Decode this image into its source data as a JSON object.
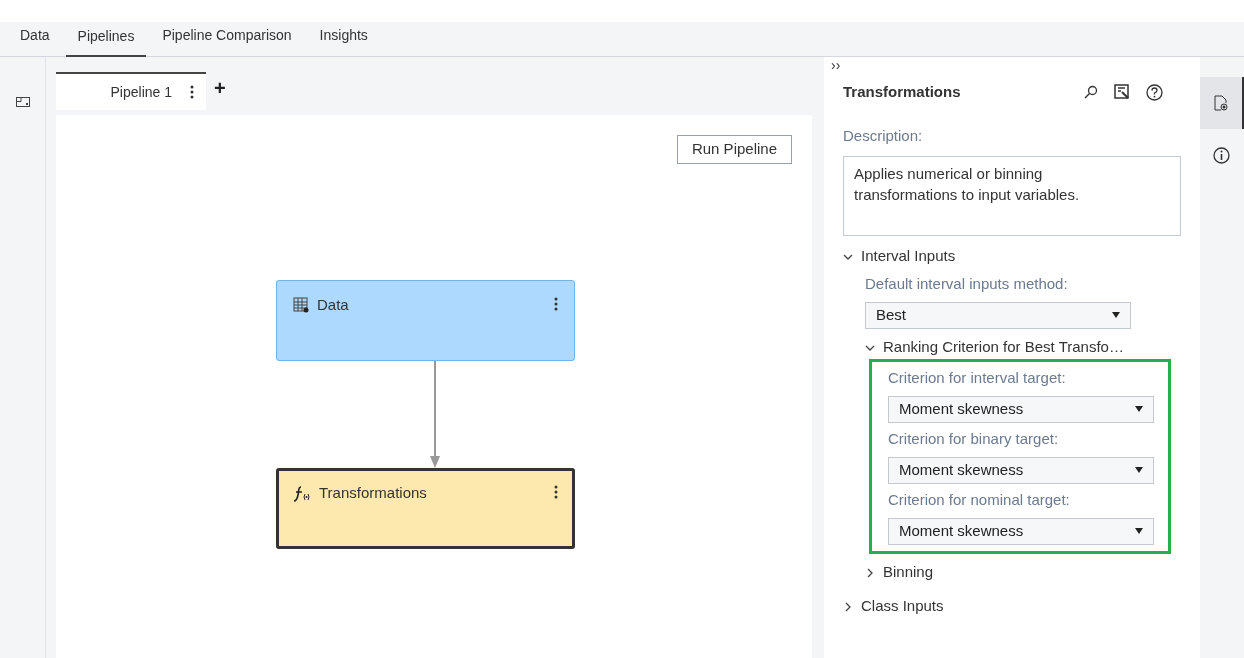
{
  "main_tabs": [
    {
      "label": "Data",
      "selected": false
    },
    {
      "label": "Pipelines",
      "selected": true
    },
    {
      "label": "Pipeline Comparison",
      "selected": false
    },
    {
      "label": "Insights",
      "selected": false
    }
  ],
  "pipeline_tabs": [
    {
      "label": "Pipeline 1",
      "selected": true
    }
  ],
  "add_tab": "+",
  "run_button": "Run Pipeline",
  "nodes": [
    {
      "kind": "data",
      "label": "Data",
      "selected": false
    },
    {
      "kind": "transform",
      "label": "Transformations",
      "selected": true
    }
  ],
  "panel": {
    "collapse": "››",
    "title": "Transformations",
    "description_label": "Description:",
    "description": "Applies numerical or binning transformations to input variables.",
    "sections": [
      {
        "title": "Interval Inputs",
        "expanded": true,
        "fields": [
          {
            "label": "Default interval inputs method:",
            "value": "Best"
          }
        ],
        "children": [
          {
            "title": "Ranking Criterion for Best Transfo…",
            "expanded": true,
            "highlighted": true,
            "fields": [
              {
                "label": "Criterion for interval target:",
                "value": "Moment skewness"
              },
              {
                "label": "Criterion for binary target:",
                "value": "Moment skewness"
              },
              {
                "label": "Criterion for nominal target:",
                "value": "Moment skewness"
              }
            ]
          },
          {
            "title": "Binning",
            "expanded": false
          }
        ]
      },
      {
        "title": "Class Inputs",
        "expanded": false
      }
    ]
  },
  "right_rail": [
    {
      "selected": true
    },
    {
      "selected": false
    }
  ]
}
